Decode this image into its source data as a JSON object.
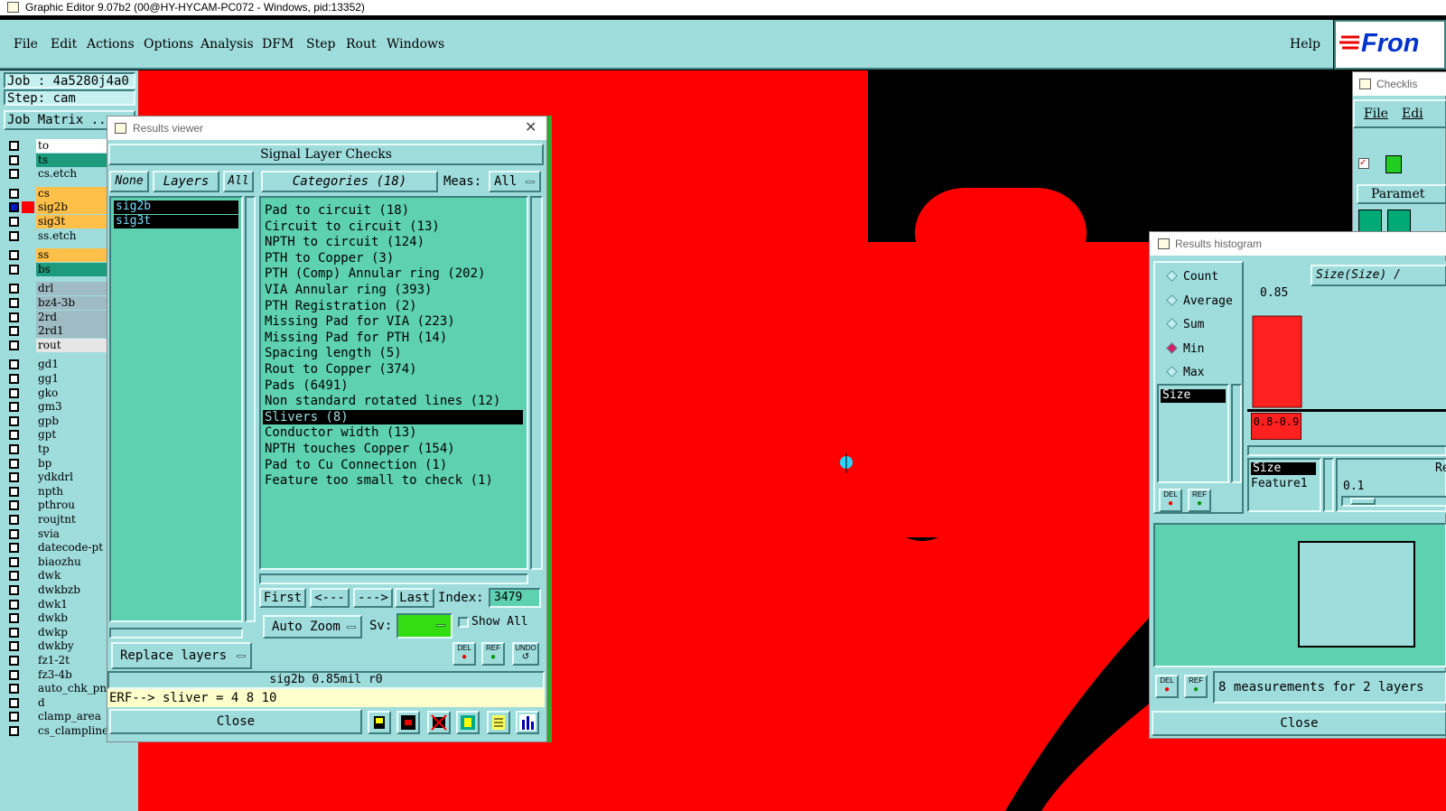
{
  "window": {
    "title": "Graphic Editor 9.07b2 (00@HY-HYCAM-PC072 - Windows, pid:13352)"
  },
  "menu": {
    "items": [
      "File",
      "Edit",
      "Actions",
      "Options",
      "Analysis",
      "DFM",
      "Step",
      "Rout",
      "Windows"
    ],
    "help": "Help"
  },
  "logo": {
    "text": "Fron"
  },
  "left": {
    "job": "Job : 4a5280j4a0",
    "step": "Step: cam",
    "job_matrix": "Job Matrix ..",
    "layers": [
      {
        "name": "to",
        "color": "#ffffff"
      },
      {
        "name": "ts",
        "color": "#1d9b7d"
      },
      {
        "name": "cs.etch",
        "color": "#9fdcdc"
      },
      {
        "name": "cs",
        "color": "#ffc04a"
      },
      {
        "name": "sig2b",
        "color": "#ffc04a",
        "sel": true
      },
      {
        "name": "sig3t",
        "color": "#ffc04a"
      },
      {
        "name": "ss.etch",
        "color": "#9fdcdc"
      },
      {
        "name": "ss",
        "color": "#ffc04a"
      },
      {
        "name": "bs",
        "color": "#1d9b7d"
      },
      {
        "name": "drl",
        "color": "#9fbcc4"
      },
      {
        "name": "bz4-3b",
        "color": "#9fbcc4"
      },
      {
        "name": "2rd",
        "color": "#9fbcc4"
      },
      {
        "name": "2rd1",
        "color": "#9fbcc4"
      },
      {
        "name": "rout",
        "color": "#e6e6e6"
      },
      {
        "name": "gd1",
        "color": "#9fdcdc"
      },
      {
        "name": "gg1",
        "color": "#9fdcdc"
      },
      {
        "name": "gko",
        "color": "#9fdcdc"
      },
      {
        "name": "gm3",
        "color": "#9fdcdc"
      },
      {
        "name": "gpb",
        "color": "#9fdcdc"
      },
      {
        "name": "gpt",
        "color": "#9fdcdc"
      },
      {
        "name": "tp",
        "color": "#9fdcdc"
      },
      {
        "name": "bp",
        "color": "#9fdcdc"
      },
      {
        "name": "ydkdrl",
        "color": "#9fdcdc"
      },
      {
        "name": "npth",
        "color": "#9fdcdc"
      },
      {
        "name": "pthrou",
        "color": "#9fdcdc"
      },
      {
        "name": "roujtnt",
        "color": "#9fdcdc"
      },
      {
        "name": "svia",
        "color": "#9fdcdc"
      },
      {
        "name": "datecode-pt",
        "color": "#9fdcdc"
      },
      {
        "name": "biaozhu",
        "color": "#9fdcdc"
      },
      {
        "name": "dwk",
        "color": "#9fdcdc"
      },
      {
        "name": "dwkbzb",
        "color": "#9fdcdc"
      },
      {
        "name": "dwk1",
        "color": "#9fdcdc"
      },
      {
        "name": "dwkb",
        "color": "#9fdcdc"
      },
      {
        "name": "dwkp",
        "color": "#9fdcdc"
      },
      {
        "name": "dwkby",
        "color": "#9fdcdc"
      },
      {
        "name": "fz1-2t",
        "color": "#9fdcdc"
      },
      {
        "name": "fz3-4b",
        "color": "#9fdcdc"
      },
      {
        "name": "auto_chk_pn",
        "color": "#9fdcdc"
      },
      {
        "name": "d",
        "color": "#9fdcdc"
      },
      {
        "name": "clamp_area",
        "color": "#9fdcdc"
      },
      {
        "name": "cs_clampline",
        "color": "#9fdcdc"
      }
    ]
  },
  "rv": {
    "title": "Results viewer",
    "header": "Signal Layer Checks",
    "none": "None",
    "layers": "Layers",
    "all": "All",
    "categories": "Categories (18)",
    "meas_label": "Meas:",
    "meas_value": "All",
    "layer_list": [
      "sig2b",
      "sig3t"
    ],
    "cats": [
      "Pad to circuit (18)",
      "Circuit to circuit (13)",
      "NPTH to circuit (124)",
      "PTH to Copper (3)",
      "PTH (Comp) Annular ring (202)",
      "VIA Annular ring (393)",
      "PTH Registration (2)",
      "Missing Pad for VIA (223)",
      "Missing Pad for PTH (14)",
      "Spacing length (5)",
      "Rout to Copper (374)",
      "Pads (6491)",
      "Non standard rotated lines (12)",
      "Slivers (8)",
      "Conductor width (13)",
      "NPTH touches Copper (154)",
      "Pad to Cu Connection (1)",
      "Feature too small to check (1)"
    ],
    "selected": "Slivers (8)",
    "first": "First",
    "prev": "<---",
    "next": "--->",
    "last": "Last",
    "index_label": "Index:",
    "index_value": "3479",
    "auto_zoom": "Auto Zoom",
    "sv": "Sv:",
    "show_all": "Show All",
    "replace": "Replace layers",
    "del": "DEL",
    "ref": "REF",
    "undo": "UNDO",
    "status": "sig2b 0.85mil  r0",
    "erf": "ERF--> sliver = 4 8 10",
    "close": "Close"
  },
  "hist": {
    "title": "Results histogram",
    "options": [
      "Count",
      "Average",
      "Sum",
      "Min",
      "Max"
    ],
    "selected_option": "Min",
    "axis_title": "Size(Size) /",
    "bar_value": "0.85",
    "bin_label": "0.8-0.9",
    "field": "Size",
    "list": [
      "Size",
      "Feature1"
    ],
    "range_label": "Re",
    "range_value": "0.1",
    "del": "DEL",
    "ref": "REF",
    "summary": "8 measurements for 2 layers",
    "close": "Close",
    "chart_data": {
      "type": "bar",
      "categories": [
        "0.8-0.9"
      ],
      "values": [
        0.85
      ],
      "title": "Size(Size) /"
    }
  },
  "checklist": {
    "title": "Checklis",
    "menu": [
      "File",
      "Edi"
    ],
    "param": "Paramet"
  }
}
